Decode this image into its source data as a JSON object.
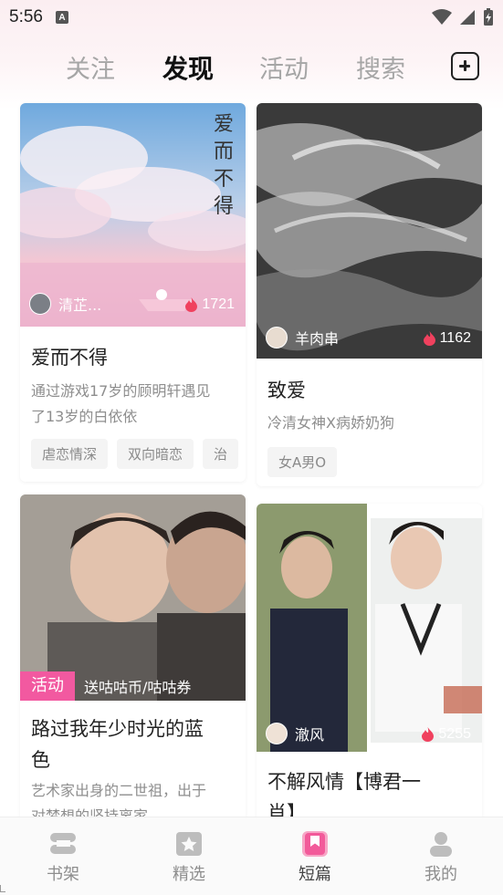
{
  "status_bar": {
    "time": "5:56",
    "notification_icon": "A"
  },
  "tabs": [
    {
      "label": "关注",
      "active": false
    },
    {
      "label": "发现",
      "active": true
    },
    {
      "label": "活动",
      "active": false
    },
    {
      "label": "搜索",
      "active": false
    }
  ],
  "cards": [
    {
      "author": "清芷...",
      "heat": "1721",
      "title": "爱而不得",
      "desc_line1": "通过游戏17岁的顾明轩遇见",
      "desc_line2": "了13岁的白依依",
      "tags": [
        "虐恋情深",
        "双向暗恋",
        "治"
      ]
    },
    {
      "author": "羊肉串",
      "heat": "1162",
      "title": "致爱",
      "desc_line1": "冷清女神X病娇奶狗",
      "tags": [
        "女A男O"
      ]
    },
    {
      "promo_label": "活动",
      "promo_text": "送咕咕币/咕咕券",
      "title_line1": "路过我年少时光的蓝",
      "title_line2": "色",
      "desc_line1": "艺术家出身的二世祖，出于",
      "desc_line2": "对梦想的坚持离家..."
    },
    {
      "author": "澈风",
      "heat": "5255",
      "title_line1": "不解风情【博君一",
      "title_line2": "肖】"
    }
  ],
  "bottom_nav": [
    {
      "label": "书架",
      "icon": "bookshelf-icon",
      "active": false
    },
    {
      "label": "精选",
      "icon": "star-icon",
      "active": false
    },
    {
      "label": "短篇",
      "icon": "bookmark-icon",
      "active": true
    },
    {
      "label": "我的",
      "icon": "user-icon",
      "active": false
    }
  ],
  "colors": {
    "accent": "#f259a0",
    "tab_active": "#111111",
    "tab_inactive": "#a6a6a6"
  }
}
